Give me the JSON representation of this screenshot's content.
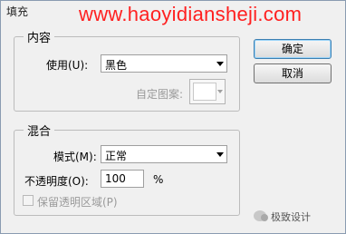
{
  "window": {
    "title": "填充"
  },
  "watermark": "www.haoyidiansheji.com",
  "content_group": {
    "legend": "内容",
    "use_label": "使用(U):",
    "use_value": "黑色",
    "custom_pattern_label": "自定图案:"
  },
  "blend_group": {
    "legend": "混合",
    "mode_label": "模式(M):",
    "mode_value": "正常",
    "opacity_label": "不透明度(O):",
    "opacity_value": "100",
    "opacity_unit": "%",
    "preserve_transparency_label": "保留透明区域(P)",
    "preserve_transparency_checked": false
  },
  "buttons": {
    "ok": "确定",
    "cancel": "取消"
  },
  "brand": "极致设计",
  "icons": {
    "dropdown": "chevron-down-icon",
    "brand": "wechat-icon"
  }
}
